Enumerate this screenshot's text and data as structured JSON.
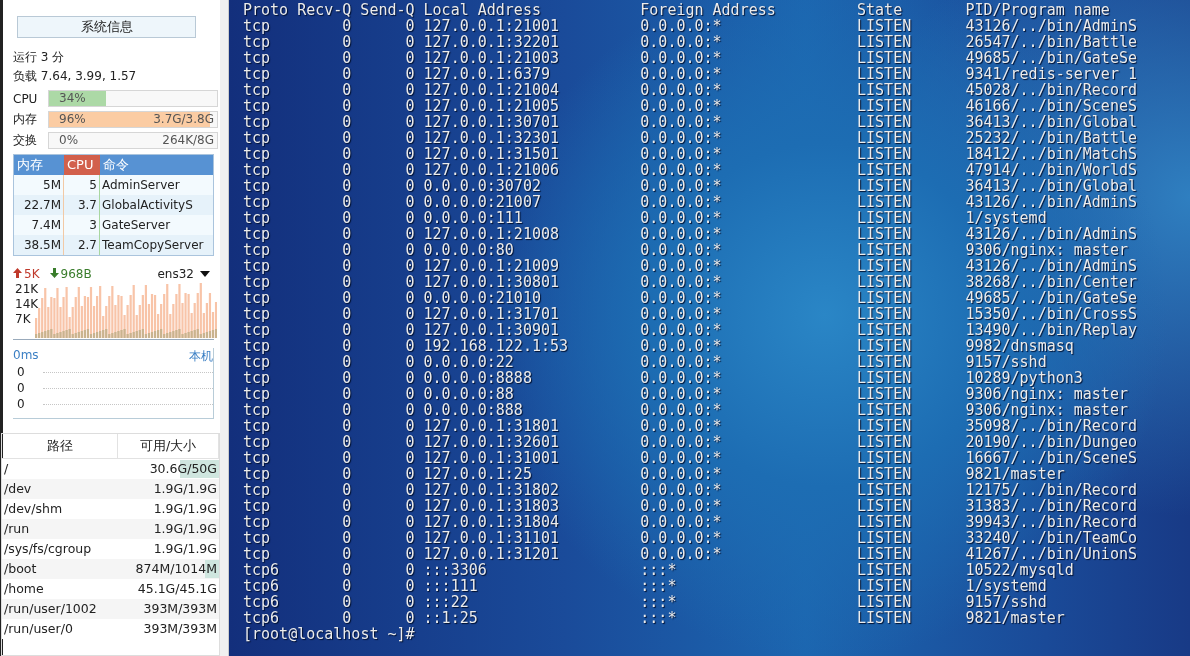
{
  "sidebar": {
    "info_button": "系统信息",
    "uptime": "运行 3 分",
    "load": "负载 7.64, 3.99, 1.57",
    "meters": [
      {
        "label": "CPU",
        "level": 0.34,
        "percent": "34%",
        "color": "#acd9a6"
      },
      {
        "label": "内存",
        "level": 0.96,
        "percent": "96%",
        "reading": "3.7G/3.8G",
        "color": "#fbcca3"
      },
      {
        "label": "交换",
        "percent": "0%",
        "reading": "264K/8G"
      }
    ],
    "processes": {
      "columns": [
        {
          "label": "内存",
          "sorted": false
        },
        {
          "label": "CPU",
          "sorted": true
        },
        {
          "label": "命令",
          "sorted": false
        }
      ],
      "rows": [
        {
          "memory": "5M",
          "cpu": "5",
          "command": "AdminServer"
        },
        {
          "memory": "22.7M",
          "cpu": "3.7",
          "command": "GlobalActivityS"
        },
        {
          "memory": "7.4M",
          "cpu": "3",
          "command": "GateServer"
        },
        {
          "memory": "38.5M",
          "cpu": "2.7",
          "command": "TeamCopyServer"
        }
      ]
    },
    "network": {
      "upload": "5K",
      "download": "968B",
      "interface": "ens32",
      "axis_labels": [
        "21K",
        "14K",
        "7K"
      ]
    },
    "latency": {
      "value": "0ms",
      "target": "本机",
      "readings": [
        "0",
        "0",
        "0"
      ]
    },
    "disks": {
      "columns": [
        "路径",
        "可用/大小"
      ],
      "rows": [
        {
          "path": "/",
          "space": "30.6G/50G",
          "level": 0.39
        },
        {
          "path": "/dev",
          "space": "1.9G/1.9G"
        },
        {
          "path": "/dev/shm",
          "space": "1.9G/1.9G"
        },
        {
          "path": "/run",
          "space": "1.9G/1.9G"
        },
        {
          "path": "/sys/fs/cgroup",
          "space": "1.9G/1.9G"
        },
        {
          "path": "/boot",
          "space": "874M/1014M",
          "level": 0.14
        },
        {
          "path": "/home",
          "space": "45.1G/45.1G"
        },
        {
          "path": "/run/user/1002",
          "space": "393M/393M"
        },
        {
          "path": "/run/user/0",
          "space": "393M/393M"
        }
      ]
    }
  },
  "terminal": {
    "header": [
      "Proto",
      "Recv-Q",
      "Send-Q",
      "Local Address",
      "Foreign Address",
      "State",
      "PID/Program name"
    ],
    "rows": [
      [
        "tcp",
        "0",
        "0",
        "127.0.0.1:21001",
        "0.0.0.0:*",
        "LISTEN",
        "43126/../bin/AdminS"
      ],
      [
        "tcp",
        "0",
        "0",
        "127.0.0.1:32201",
        "0.0.0.0:*",
        "LISTEN",
        "26547/../bin/Battle"
      ],
      [
        "tcp",
        "0",
        "0",
        "127.0.0.1:21003",
        "0.0.0.0:*",
        "LISTEN",
        "49685/../bin/GateSe"
      ],
      [
        "tcp",
        "0",
        "0",
        "127.0.0.1:6379",
        "0.0.0.0:*",
        "LISTEN",
        "9341/redis-server 1"
      ],
      [
        "tcp",
        "0",
        "0",
        "127.0.0.1:21004",
        "0.0.0.0:*",
        "LISTEN",
        "45028/../bin/Record"
      ],
      [
        "tcp",
        "0",
        "0",
        "127.0.0.1:21005",
        "0.0.0.0:*",
        "LISTEN",
        "46166/../bin/SceneS"
      ],
      [
        "tcp",
        "0",
        "0",
        "127.0.0.1:30701",
        "0.0.0.0:*",
        "LISTEN",
        "36413/../bin/Global"
      ],
      [
        "tcp",
        "0",
        "0",
        "127.0.0.1:32301",
        "0.0.0.0:*",
        "LISTEN",
        "25232/../bin/Battle"
      ],
      [
        "tcp",
        "0",
        "0",
        "127.0.0.1:31501",
        "0.0.0.0:*",
        "LISTEN",
        "18412/../bin/MatchS"
      ],
      [
        "tcp",
        "0",
        "0",
        "127.0.0.1:21006",
        "0.0.0.0:*",
        "LISTEN",
        "47914/../bin/WorldS"
      ],
      [
        "tcp",
        "0",
        "0",
        "0.0.0.0:30702",
        "0.0.0.0:*",
        "LISTEN",
        "36413/../bin/Global"
      ],
      [
        "tcp",
        "0",
        "0",
        "0.0.0.0:21007",
        "0.0.0.0:*",
        "LISTEN",
        "43126/../bin/AdminS"
      ],
      [
        "tcp",
        "0",
        "0",
        "0.0.0.0:111",
        "0.0.0.0:*",
        "LISTEN",
        "1/systemd"
      ],
      [
        "tcp",
        "0",
        "0",
        "127.0.0.1:21008",
        "0.0.0.0:*",
        "LISTEN",
        "43126/../bin/AdminS"
      ],
      [
        "tcp",
        "0",
        "0",
        "0.0.0.0:80",
        "0.0.0.0:*",
        "LISTEN",
        "9306/nginx: master"
      ],
      [
        "tcp",
        "0",
        "0",
        "127.0.0.1:21009",
        "0.0.0.0:*",
        "LISTEN",
        "43126/../bin/AdminS"
      ],
      [
        "tcp",
        "0",
        "0",
        "127.0.0.1:30801",
        "0.0.0.0:*",
        "LISTEN",
        "38268/../bin/Center"
      ],
      [
        "tcp",
        "0",
        "0",
        "0.0.0.0:21010",
        "0.0.0.0:*",
        "LISTEN",
        "49685/../bin/GateSe"
      ],
      [
        "tcp",
        "0",
        "0",
        "127.0.0.1:31701",
        "0.0.0.0:*",
        "LISTEN",
        "15350/../bin/CrossS"
      ],
      [
        "tcp",
        "0",
        "0",
        "127.0.0.1:30901",
        "0.0.0.0:*",
        "LISTEN",
        "13490/../bin/Replay"
      ],
      [
        "tcp",
        "0",
        "0",
        "192.168.122.1:53",
        "0.0.0.0:*",
        "LISTEN",
        "9982/dnsmasq"
      ],
      [
        "tcp",
        "0",
        "0",
        "0.0.0.0:22",
        "0.0.0.0:*",
        "LISTEN",
        "9157/sshd"
      ],
      [
        "tcp",
        "0",
        "0",
        "0.0.0.0:8888",
        "0.0.0.0:*",
        "LISTEN",
        "10289/python3"
      ],
      [
        "tcp",
        "0",
        "0",
        "0.0.0.0:88",
        "0.0.0.0:*",
        "LISTEN",
        "9306/nginx: master"
      ],
      [
        "tcp",
        "0",
        "0",
        "0.0.0.0:888",
        "0.0.0.0:*",
        "LISTEN",
        "9306/nginx: master"
      ],
      [
        "tcp",
        "0",
        "0",
        "127.0.0.1:31801",
        "0.0.0.0:*",
        "LISTEN",
        "35098/../bin/Record"
      ],
      [
        "tcp",
        "0",
        "0",
        "127.0.0.1:32601",
        "0.0.0.0:*",
        "LISTEN",
        "20190/../bin/Dungeo"
      ],
      [
        "tcp",
        "0",
        "0",
        "127.0.0.1:31001",
        "0.0.0.0:*",
        "LISTEN",
        "16667/../bin/SceneS"
      ],
      [
        "tcp",
        "0",
        "0",
        "127.0.0.1:25",
        "0.0.0.0:*",
        "LISTEN",
        "9821/master"
      ],
      [
        "tcp",
        "0",
        "0",
        "127.0.0.1:31802",
        "0.0.0.0:*",
        "LISTEN",
        "12175/../bin/Record"
      ],
      [
        "tcp",
        "0",
        "0",
        "127.0.0.1:31803",
        "0.0.0.0:*",
        "LISTEN",
        "31383/../bin/Record"
      ],
      [
        "tcp",
        "0",
        "0",
        "127.0.0.1:31804",
        "0.0.0.0:*",
        "LISTEN",
        "39943/../bin/Record"
      ],
      [
        "tcp",
        "0",
        "0",
        "127.0.0.1:31101",
        "0.0.0.0:*",
        "LISTEN",
        "33240/../bin/TeamCo"
      ],
      [
        "tcp",
        "0",
        "0",
        "127.0.0.1:31201",
        "0.0.0.0:*",
        "LISTEN",
        "41267/../bin/UnionS"
      ],
      [
        "tcp6",
        "0",
        "0",
        ":::3306",
        ":::*",
        "LISTEN",
        "10522/mysqld"
      ],
      [
        "tcp6",
        "0",
        "0",
        ":::111",
        ":::*",
        "LISTEN",
        "1/systemd"
      ],
      [
        "tcp6",
        "0",
        "0",
        ":::22",
        ":::*",
        "LISTEN",
        "9157/sshd"
      ],
      [
        "tcp6",
        "0",
        "0",
        "::1:25",
        ":::*",
        "LISTEN",
        "9821/master"
      ]
    ],
    "prompt": "[root@localhost ~]#"
  }
}
